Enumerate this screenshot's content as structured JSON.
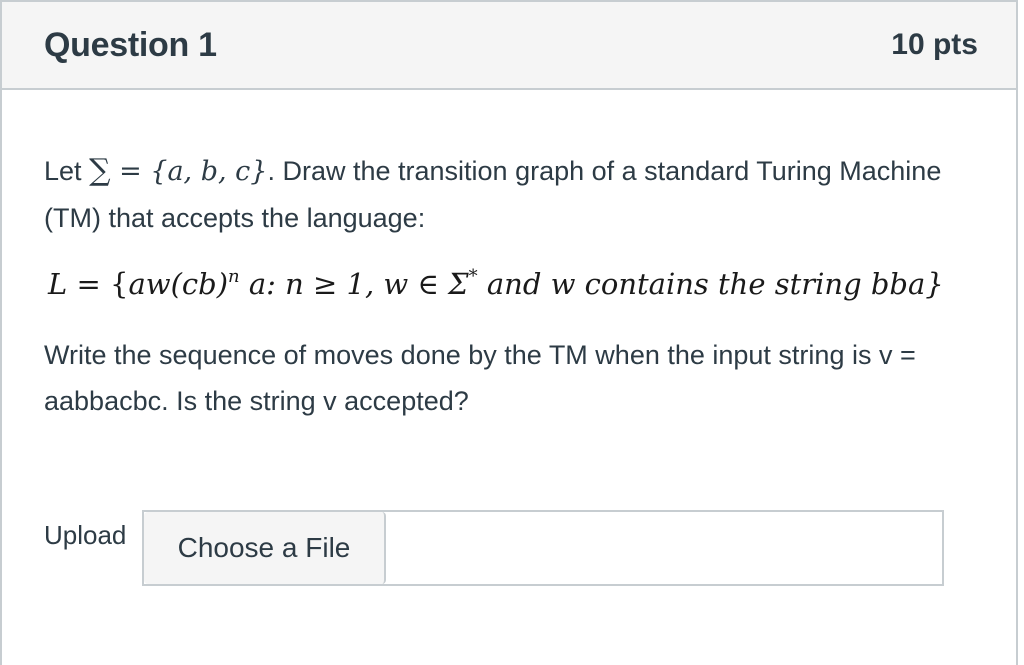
{
  "question": {
    "title": "Question 1",
    "points": "10 pts"
  },
  "prompt": {
    "p1_lead": "Let",
    "p1_sigma": "∑",
    "p1_set": " = {a, b, c}",
    "p1_rest": ". Draw the transition graph of a standard Turing Machine (TM) that accepts the language:",
    "formula": {
      "lhs": "L",
      "eq": " = {",
      "aw": "aw",
      "cb": "(cb)",
      "n_sup": "n",
      "a_colon": " a: ",
      "cond": "n ≥ 1, w ∈ Σ",
      "star": "*",
      "tail": " and w contains the string bba}"
    },
    "p2": "Write the sequence of moves done by the TM when the input string is v = aabbacbc. Is the string v accepted?"
  },
  "upload": {
    "label": "Upload",
    "button_label": "Choose a File",
    "selected_file": ""
  }
}
